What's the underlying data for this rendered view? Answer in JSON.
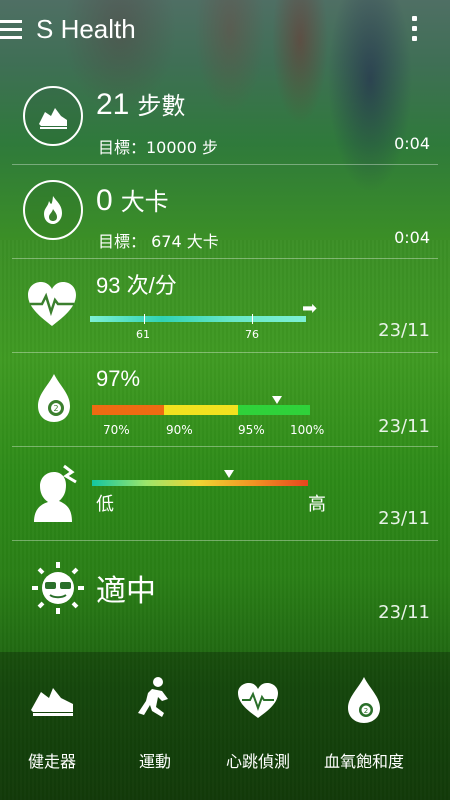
{
  "header": {
    "title": "S Health"
  },
  "steps": {
    "value": "21",
    "unit": "步數",
    "goal": "目標：10000 步",
    "time": "0:04"
  },
  "calories": {
    "value": "0",
    "unit": "大卡",
    "goal": "目標： 674 大卡",
    "time": "0:04"
  },
  "heart_rate": {
    "value": "93 次/分",
    "tick_low": "61",
    "tick_high": "76",
    "date": "23/11"
  },
  "spo2": {
    "value": "97%",
    "labels": [
      "70%",
      "90%",
      "95%",
      "100%"
    ],
    "date": "23/11",
    "colors": [
      "#ee6b12",
      "#f2e21f",
      "#2fd23a"
    ]
  },
  "stress": {
    "low": "低",
    "high": "高",
    "date": "23/11"
  },
  "uv": {
    "value": "適中",
    "date": "23/11"
  },
  "bottom_nav": {
    "items": [
      {
        "label": "健走器",
        "icon": "shoe-icon"
      },
      {
        "label": "運動",
        "icon": "runner-icon"
      },
      {
        "label": "心跳偵測",
        "icon": "heart-rate-icon"
      },
      {
        "label": "血氧飽和度",
        "icon": "oxygen-drop-icon"
      }
    ]
  }
}
